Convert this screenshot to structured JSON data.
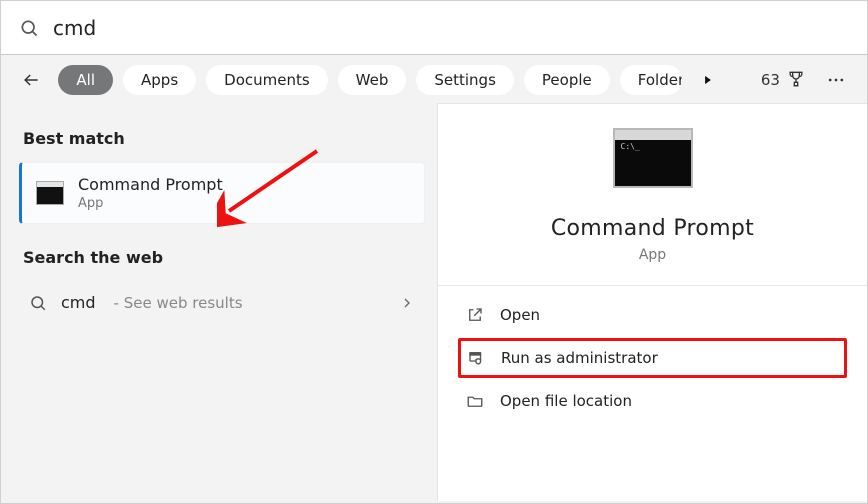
{
  "search": {
    "value": "cmd"
  },
  "filters": {
    "items": [
      "All",
      "Apps",
      "Documents",
      "Web",
      "Settings",
      "People",
      "Folders"
    ],
    "active_index": 0
  },
  "header_right": {
    "count": "63"
  },
  "left": {
    "best_match_heading": "Best match",
    "result": {
      "title": "Command Prompt",
      "subtitle": "App"
    },
    "web_heading": "Search the web",
    "web_row": {
      "query": "cmd",
      "hint": "- See web results"
    }
  },
  "right": {
    "title": "Command Prompt",
    "subtitle": "App",
    "actions": {
      "open": "Open",
      "run_admin": "Run as administrator",
      "open_location": "Open file location"
    }
  }
}
